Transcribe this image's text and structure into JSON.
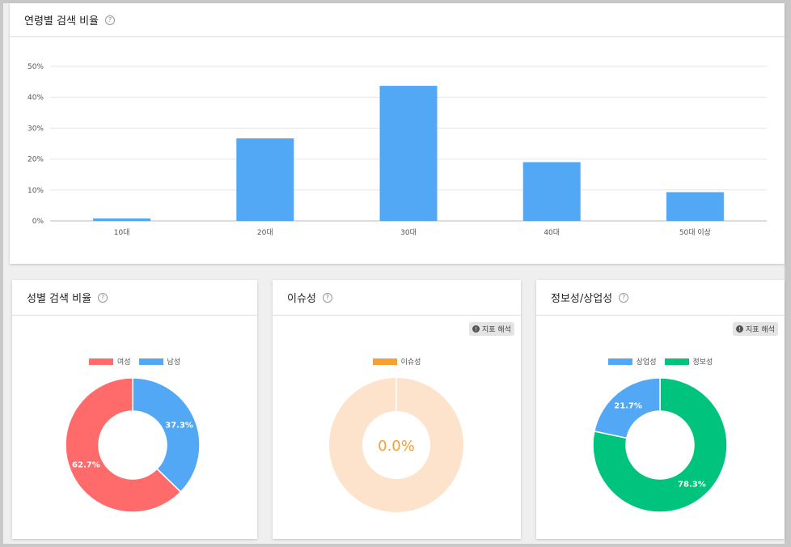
{
  "age_card": {
    "title": "연령별 검색 비율",
    "help_icon": "?"
  },
  "gender_card": {
    "title": "성별 검색 비율",
    "help_icon": "?"
  },
  "issue_card": {
    "title": "이슈성",
    "help_icon": "?",
    "badge_icon": "!",
    "badge_label": "지표 해석"
  },
  "info_card": {
    "title": "정보성/상업성",
    "help_icon": "?",
    "badge_icon": "!",
    "badge_label": "지표 해석"
  },
  "colors": {
    "bar": "#52a8f5",
    "female": "#ff6b6b",
    "male": "#52a8f5",
    "issue": "#f5a033",
    "issue_bg": "#fde3cc",
    "commercial": "#52a8f5",
    "informational": "#00c47d"
  },
  "chart_data": [
    {
      "type": "bar",
      "title": "연령별 검색 비율",
      "categories": [
        "10대",
        "20대",
        "30대",
        "40대",
        "50대 이상"
      ],
      "values": [
        0.8,
        26.7,
        43.7,
        19.0,
        9.3
      ],
      "ylim": [
        0,
        50
      ],
      "yticks": [
        0,
        10,
        20,
        30,
        40,
        50
      ],
      "ytick_labels": [
        "0%",
        "10%",
        "20%",
        "30%",
        "40%",
        "50%"
      ],
      "grid": true
    },
    {
      "type": "pie",
      "title": "성별 검색 비율",
      "donut": true,
      "series": [
        {
          "name": "여성",
          "value": 62.7,
          "label": "62.7%"
        },
        {
          "name": "남성",
          "value": 37.3,
          "label": "37.3%"
        }
      ],
      "legend": "top"
    },
    {
      "type": "pie",
      "title": "이슈성",
      "donut": true,
      "series": [
        {
          "name": "이슈성",
          "value": 0.0
        }
      ],
      "center_label": "0.0%",
      "legend": "top"
    },
    {
      "type": "pie",
      "title": "정보성/상업성",
      "donut": true,
      "series": [
        {
          "name": "상업성",
          "value": 21.7,
          "label": "21.7%"
        },
        {
          "name": "정보성",
          "value": 78.3,
          "label": "78.3%"
        }
      ],
      "legend": "top"
    }
  ]
}
